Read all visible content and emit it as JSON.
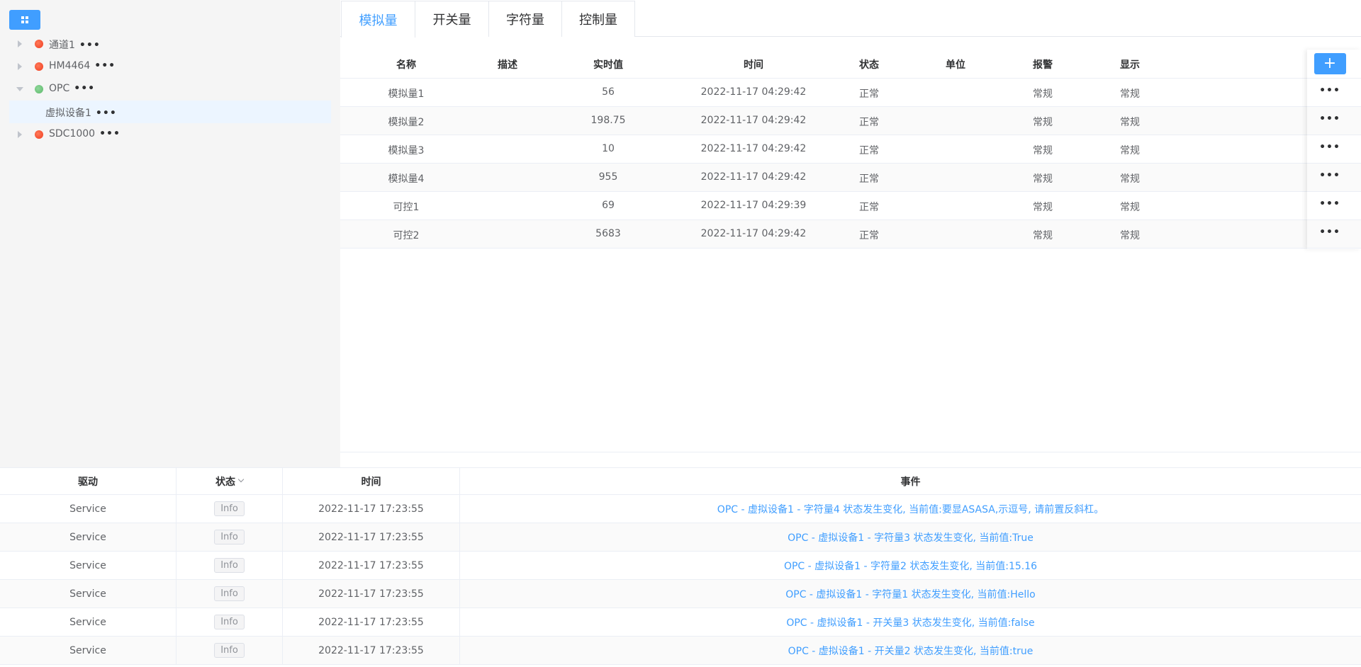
{
  "tree": {
    "nodes": [
      {
        "label": "通道1",
        "status": "red",
        "expanded": false
      },
      {
        "label": "HM4464",
        "status": "red",
        "expanded": false
      },
      {
        "label": "OPC",
        "status": "green",
        "expanded": true
      },
      {
        "label": "虚拟设备1",
        "child": true,
        "selected": true
      },
      {
        "label": "SDC1000",
        "status": "red",
        "expanded": false
      }
    ],
    "more": "•••"
  },
  "tabs": [
    "模拟量",
    "开关量",
    "字符量",
    "控制量"
  ],
  "data_table": {
    "headers": [
      "名称",
      "描述",
      "实时值",
      "时间",
      "状态",
      "单位",
      "报警",
      "显示"
    ],
    "add_label": "+",
    "row_more": "•••",
    "rows": [
      [
        "模拟量1",
        "",
        "56",
        "2022-11-17 04:29:42",
        "正常",
        "",
        "常规",
        "常规"
      ],
      [
        "模拟量2",
        "",
        "198.75",
        "2022-11-17 04:29:42",
        "正常",
        "",
        "常规",
        "常规"
      ],
      [
        "模拟量3",
        "",
        "10",
        "2022-11-17 04:29:42",
        "正常",
        "",
        "常规",
        "常规"
      ],
      [
        "模拟量4",
        "",
        "955",
        "2022-11-17 04:29:42",
        "正常",
        "",
        "常规",
        "常规"
      ],
      [
        "可控1",
        "",
        "69",
        "2022-11-17 04:29:39",
        "正常",
        "",
        "常规",
        "常规"
      ],
      [
        "可控2",
        "",
        "5683",
        "2022-11-17 04:29:42",
        "正常",
        "",
        "常规",
        "常规"
      ]
    ]
  },
  "log_table": {
    "headers": [
      "驱动",
      "状态",
      "时间",
      "事件"
    ],
    "rows": [
      [
        "Service",
        "Info",
        "2022-11-17 17:23:55",
        "OPC - 虚拟设备1 - 字符量4 状态发生变化, 当前值:要显ASASA,示逗号, 请前置反斜杠。"
      ],
      [
        "Service",
        "Info",
        "2022-11-17 17:23:55",
        "OPC - 虚拟设备1 - 字符量3 状态发生变化, 当前值:True"
      ],
      [
        "Service",
        "Info",
        "2022-11-17 17:23:55",
        "OPC - 虚拟设备1 - 字符量2 状态发生变化, 当前值:15.16"
      ],
      [
        "Service",
        "Info",
        "2022-11-17 17:23:55",
        "OPC - 虚拟设备1 - 字符量1 状态发生变化, 当前值:Hello"
      ],
      [
        "Service",
        "Info",
        "2022-11-17 17:23:55",
        "OPC - 虚拟设备1 - 开关量3 状态发生变化, 当前值:false"
      ],
      [
        "Service",
        "Info",
        "2022-11-17 17:23:55",
        "OPC - 虚拟设备1 - 开关量2 状态发生变化, 当前值:true"
      ]
    ]
  },
  "colors": {
    "accent": "#409eff",
    "status_ok": "#5cb86a",
    "status_err": "#f03c1e"
  }
}
